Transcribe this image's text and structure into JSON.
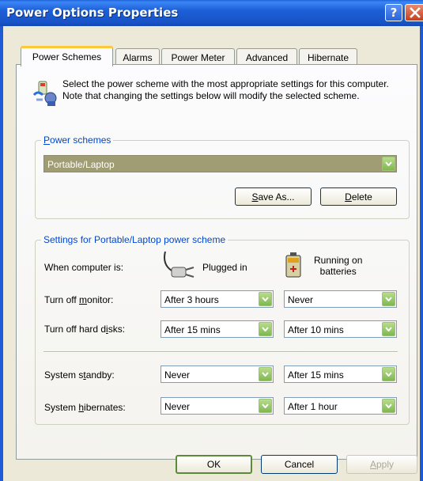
{
  "window": {
    "title": "Power Options Properties",
    "help_label": "?"
  },
  "tabs": [
    {
      "label": "Power Schemes",
      "active": true
    },
    {
      "label": "Alarms",
      "active": false
    },
    {
      "label": "Power Meter",
      "active": false
    },
    {
      "label": "Advanced",
      "active": false
    },
    {
      "label": "Hibernate",
      "active": false
    }
  ],
  "intro": {
    "text": "Select the power scheme with the most appropriate settings for this computer. Note that changing the settings below will modify the selected scheme.",
    "icon": "power-scheme-icon"
  },
  "power_schemes": {
    "group_label_accel": "P",
    "group_label_rest": "ower schemes",
    "selected": "Portable/Laptop",
    "save_as": {
      "accel": "S",
      "rest": "ave As..."
    },
    "delete": {
      "accel": "D",
      "rest": "elete"
    }
  },
  "settings": {
    "group_label": "Settings for Portable/Laptop power scheme",
    "when_label": "When computer is:",
    "plugged_in": "Plugged in",
    "running_on_line1": "Running on",
    "running_on_line2": "batteries",
    "rows": [
      {
        "pre": "Turn off ",
        "accel": "m",
        "post": "onitor:",
        "plugged": "After 3 hours",
        "battery": "Never"
      },
      {
        "pre": "Turn off hard d",
        "accel": "i",
        "post": "sks:",
        "plugged": "After 15 mins",
        "battery": "After 10 mins"
      },
      {
        "pre": "System s",
        "accel": "t",
        "post": "andby:",
        "plugged": "Never",
        "battery": "After 15 mins"
      },
      {
        "pre": "System ",
        "accel": "h",
        "post": "ibernates:",
        "plugged": "Never",
        "battery": "After 1 hour"
      }
    ]
  },
  "footer": {
    "ok": "OK",
    "cancel": "Cancel",
    "apply_accel": "A",
    "apply_rest": "pply"
  },
  "colors": {
    "titlebar": "#1d5fd6",
    "group_label": "#0046d5",
    "dropdown_arrow": "#8fc463",
    "selected_field": "#a09c73"
  }
}
